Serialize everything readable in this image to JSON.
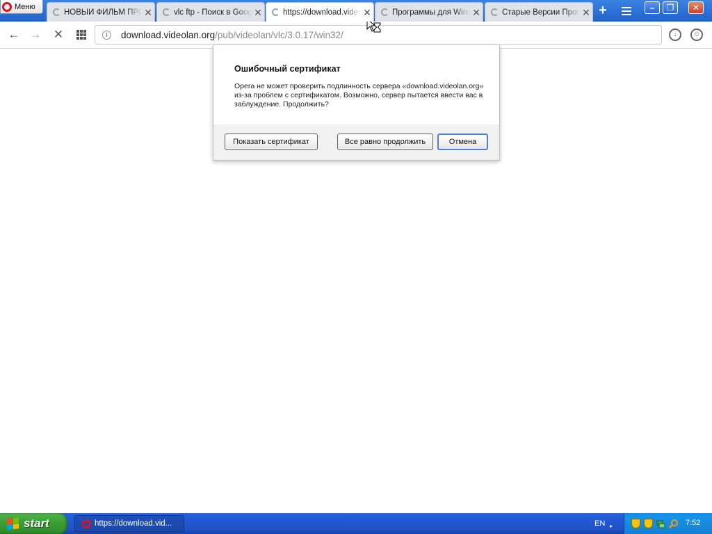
{
  "browser": {
    "menu_label": "Меню",
    "tabs": [
      {
        "title": "НОВЫЙ ФИЛЬМ ПРОЦ",
        "active": false
      },
      {
        "title": "vlc ftp - Поиск в Google",
        "active": false
      },
      {
        "title": "https://download.videolan.org",
        "active": true
      },
      {
        "title": "Программы для Windows",
        "active": false
      },
      {
        "title": "Старые Версии Программ",
        "active": false
      }
    ],
    "new_tab_glyph": "+",
    "tab_menu_icon": "tab-menu-icon",
    "window_buttons": {
      "minimize": "–",
      "restore": "❐",
      "close": "✕"
    }
  },
  "navbar": {
    "back_glyph": "←",
    "forward_glyph": "→",
    "stop_glyph": "✕",
    "url_host": "download.videolan.org",
    "url_path": "/pub/videolan/vlc/3.0.17/win32/",
    "info_glyph": "i",
    "download_glyph": "↓",
    "account_glyph": "☺"
  },
  "dialog": {
    "title": "Ошибочный сертификат",
    "message": "Opera не может проверить подлинность сервера «download.videolan.org» из-за проблем с сертификатом. Возможно, сервер пытается ввести вас в заблуждение. Продолжить?",
    "buttons": {
      "show_cert": "Показать сертификат",
      "continue": "Все равно продолжить",
      "cancel": "Отмена"
    }
  },
  "taskbar": {
    "start_label": "start",
    "task_item": "https://download.vid...",
    "language": "EN",
    "clock": "7:52"
  },
  "colors": {
    "accent": "#2a6fd6",
    "opera_red": "#d8141e",
    "start_green": "#3b9c36"
  }
}
